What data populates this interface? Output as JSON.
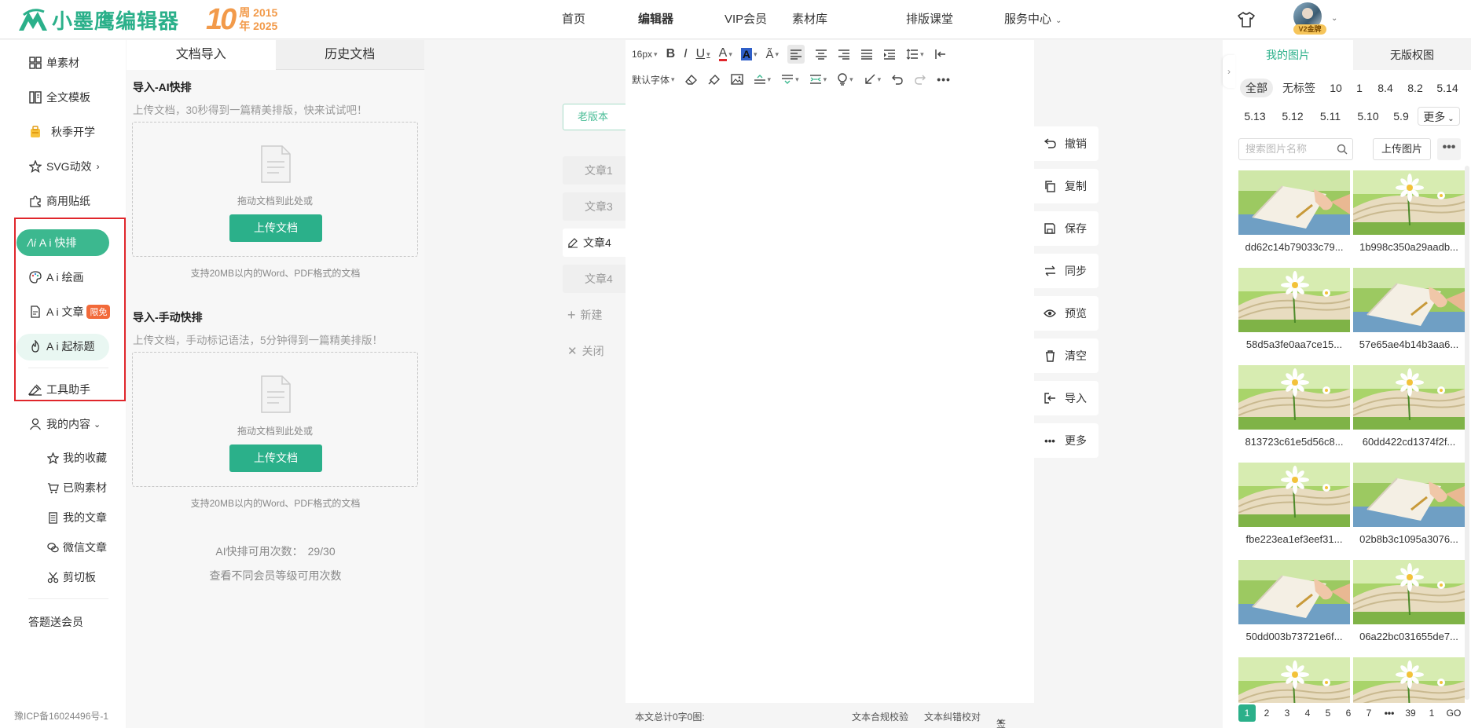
{
  "header": {
    "logo_text": "小墨鹰编辑器",
    "anniv_num": "10",
    "anniv_top": "周 2015",
    "anniv_bottom": "年 2025",
    "nav": [
      {
        "label": "首页"
      },
      {
        "label": "编辑器"
      },
      {
        "label": "VIP会员"
      },
      {
        "label": "素材库"
      },
      {
        "label": "排版课堂"
      },
      {
        "label": "服务中心"
      }
    ],
    "vip_badge": "V2金牌"
  },
  "leftnav": {
    "items": [
      {
        "label": "单素材"
      },
      {
        "label": "全文模板"
      },
      {
        "label": "秋季开学"
      },
      {
        "label": "SVG动效"
      },
      {
        "label": "商用贴纸"
      }
    ],
    "ai_items": [
      {
        "label": "A i 快排"
      },
      {
        "label": "A i 绘画"
      },
      {
        "label": "A i 文章",
        "badge": "限免"
      },
      {
        "label": "A i 起标题"
      }
    ],
    "tools": "工具助手",
    "my_content": "我的内容",
    "sub_items": [
      {
        "label": "我的收藏"
      },
      {
        "label": "已购素材"
      },
      {
        "label": "我的文章"
      },
      {
        "label": "微信文章"
      },
      {
        "label": "剪切板"
      }
    ],
    "quiz": "答题送会员",
    "icp": "豫ICP备16024496号-1"
  },
  "import_panel": {
    "tabs": [
      "文档导入",
      "历史文档"
    ],
    "ai_title": "导入-AI快排",
    "ai_desc": "上传文档，30秒得到一篇精美排版，快来试试吧！",
    "drop_text": "拖动文档到此处或",
    "upload_btn": "上传文档",
    "support": "支持20MB以内的Word、PDF格式的文档",
    "manual_title": "导入-手动快排",
    "manual_desc": "上传文档，手动标记语法，5分钟得到一篇精美排版！",
    "count_label": "AI快排可用次数：",
    "count_value": "29/30",
    "count_link": "查看不同会员等级可用次数"
  },
  "doc_tabs": {
    "old_version": "老版本",
    "tabs": [
      "文章1",
      "文章3",
      "文章4",
      "文章4"
    ],
    "new": "新建",
    "close": "关闭"
  },
  "editor": {
    "font_size": "16px",
    "font_family": "默认字体",
    "footer_count": "本文总计0字0图:",
    "footer_compliance": "文本合规校验",
    "footer_proof": "文本纠错校对",
    "footer_sign": "签名"
  },
  "actions": [
    {
      "label": "撤销",
      "icon": "undo-icon"
    },
    {
      "label": "复制",
      "icon": "copy-icon"
    },
    {
      "label": "保存",
      "icon": "save-icon"
    },
    {
      "label": "同步",
      "icon": "sync-icon"
    },
    {
      "label": "预览",
      "icon": "eye-icon"
    },
    {
      "label": "清空",
      "icon": "trash-icon"
    },
    {
      "label": "导入",
      "icon": "import-icon"
    },
    {
      "label": "更多",
      "icon": "more-icon"
    }
  ],
  "right_panel": {
    "tabs": [
      "我的图片",
      "无版权图"
    ],
    "filters_row1": [
      "全部",
      "无标签",
      "10",
      "1",
      "8.4",
      "8.2",
      "5.14"
    ],
    "filters_row2": [
      "5.13",
      "5.12",
      "5.11",
      "5.10",
      "5.9",
      "更多"
    ],
    "search_placeholder": "搜索图片名称",
    "upload": "上传图片",
    "more_dots": "•••",
    "images": [
      {
        "name": "dd62c14b79033c79...",
        "kind": "hand"
      },
      {
        "name": "1b998c350a29aadb...",
        "kind": "daisy"
      },
      {
        "name": "58d5a3fe0aa7ce15...",
        "kind": "daisy"
      },
      {
        "name": "57e65ae4b14b3aa6...",
        "kind": "hand"
      },
      {
        "name": "813723c61e5d56c8...",
        "kind": "daisy"
      },
      {
        "name": "60dd422cd1374f2f...",
        "kind": "daisy"
      },
      {
        "name": "fbe223ea1ef3eef31...",
        "kind": "daisy"
      },
      {
        "name": "02b8b3c1095a3076...",
        "kind": "hand"
      },
      {
        "name": "50dd003b73721e6f...",
        "kind": "hand"
      },
      {
        "name": "06a22bc031655de7...",
        "kind": "daisy"
      },
      {
        "name": "",
        "kind": "daisy"
      },
      {
        "name": "",
        "kind": "daisy"
      }
    ],
    "pages": [
      "1",
      "2",
      "3",
      "4",
      "5",
      "6",
      "7",
      "•••",
      "39",
      "1",
      "GO"
    ]
  }
}
